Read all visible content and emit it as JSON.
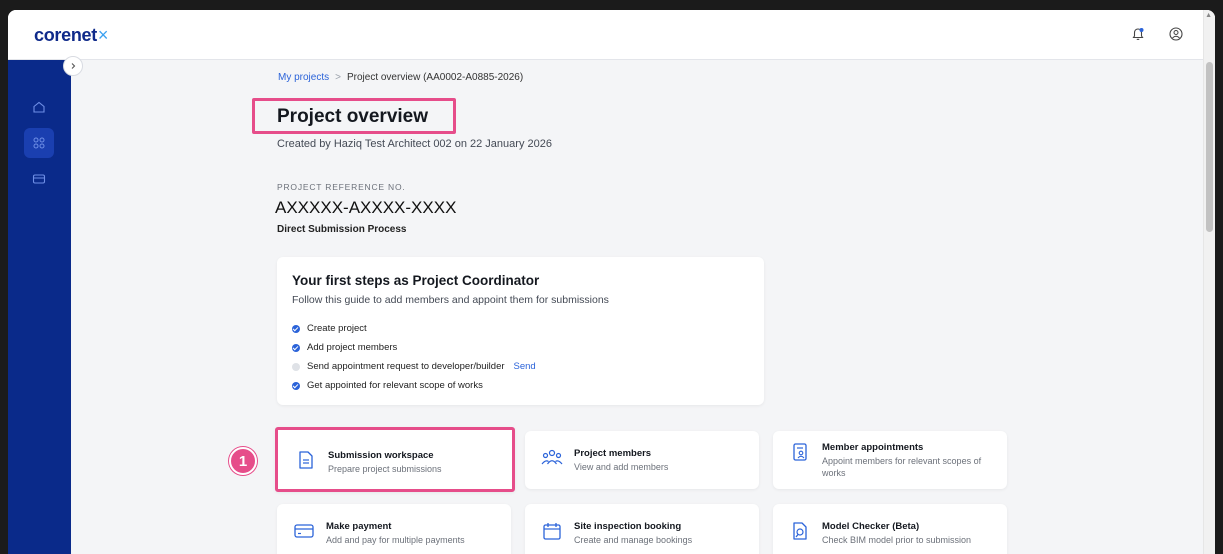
{
  "app": {
    "logo_text": "corenet",
    "logo_mark": "×"
  },
  "breadcrumb": {
    "root": "My projects",
    "separator": ">",
    "current": "Project overview (AA0002-A0885-2026)"
  },
  "header": {
    "title": "Project overview",
    "created_by": "Created by Haziq Test Architect 002 on 22 January 2026"
  },
  "reference": {
    "label": "PROJECT REFERENCE NO.",
    "value": "AXXXXX-AXXXX-XXXX",
    "process": "Direct Submission Process"
  },
  "steps_card": {
    "title": "Your first steps as Project Coordinator",
    "subtitle": "Follow this guide to add members and appoint them for submissions",
    "steps": [
      {
        "label": "Create project",
        "done": true
      },
      {
        "label": "Add project members",
        "done": true
      },
      {
        "label": "Send appointment request to developer/builder",
        "done": false,
        "action": "Send"
      },
      {
        "label": "Get appointed for relevant scope of works",
        "done": true
      }
    ]
  },
  "tiles": [
    {
      "title": "Submission workspace",
      "desc": "Prepare project submissions",
      "icon": "document-icon"
    },
    {
      "title": "Project members",
      "desc": "View and add members",
      "icon": "people-icon"
    },
    {
      "title": "Member appointments",
      "desc": "Appoint members for relevant scopes of works",
      "icon": "appointment-icon"
    },
    {
      "title": "Make payment",
      "desc": "Add and pay for multiple payments",
      "icon": "card-icon"
    },
    {
      "title": "Site inspection booking",
      "desc": "Create and manage bookings",
      "icon": "calendar-icon"
    },
    {
      "title": "Model Checker (Beta)",
      "desc": "Check BIM model prior to submission",
      "icon": "model-check-icon"
    }
  ],
  "annotation": {
    "badge": "1"
  },
  "colors": {
    "brand": "#0a2a8a",
    "accent": "#2b63d9",
    "highlight": "#e64d8a"
  }
}
